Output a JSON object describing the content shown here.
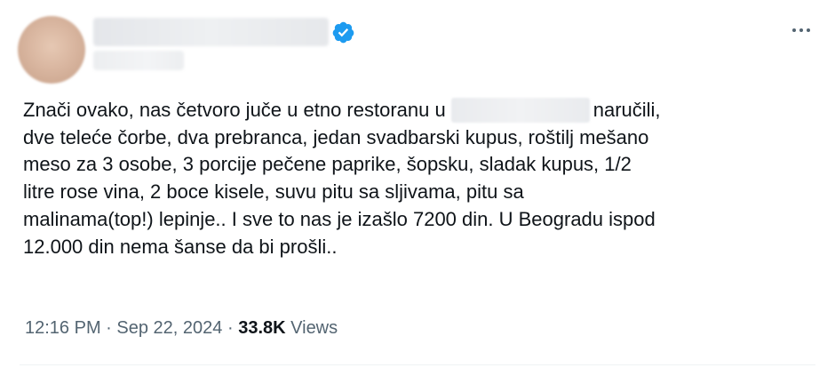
{
  "colors": {
    "accent": "#1d9bf0",
    "text_primary": "#0f1419",
    "text_secondary": "#536471"
  },
  "header": {
    "avatar_icon": "blurred-avatar",
    "verified_icon": "verified-badge-icon",
    "more_icon": "more-options-icon"
  },
  "tweet": {
    "lines": [
      {
        "before": "Znači ovako, nas četvoro juče u etno restoranu u",
        "after": "naručili,"
      },
      {
        "text": "dve teleće čorbe, dva prebranca, jedan svadbarski kupus, roštilj mešano"
      },
      {
        "text": "meso za 3 osobe, 3 porcije pečene paprike, šopsku, sladak kupus, 1/2"
      },
      {
        "text": "litre rose vina, 2 boce kisele, suvu pitu sa sljivama, pitu sa"
      },
      {
        "text": "malinama(top!) lepinje.. I sve to nas je izašlo 7200 din. U Beogradu ispod"
      },
      {
        "text": "12.000 din nema šanse da bi prošli.."
      }
    ]
  },
  "meta": {
    "time": "12:16 PM",
    "date": "Sep 22, 2024",
    "separator": "·",
    "views_count": "33.8K",
    "views_label": "Views"
  }
}
